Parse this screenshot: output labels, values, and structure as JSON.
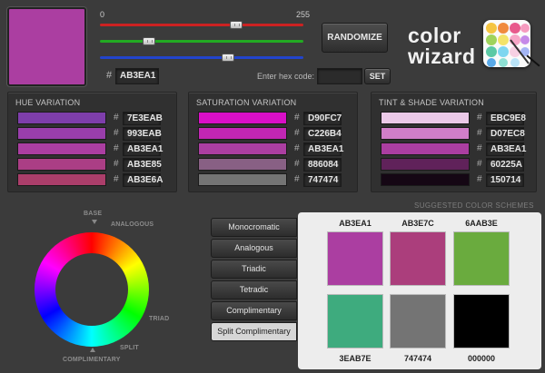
{
  "current": {
    "hex": "AB3EA1",
    "color": "#AB3EA1"
  },
  "sliders": {
    "min_label": "0",
    "max_label": "255",
    "red": {
      "value": 171,
      "track_color": "#cc2222"
    },
    "green": {
      "value": 62,
      "track_color": "#22aa22"
    },
    "blue": {
      "value": 161,
      "track_color": "#2244cc"
    }
  },
  "hex_entry": {
    "label": "Enter hex code:",
    "value": "",
    "set_button": "SET",
    "hash": "#"
  },
  "randomize_button": "RANDOMIZE",
  "logo": {
    "line1": "color",
    "line2": "wizard"
  },
  "panels": [
    {
      "title": "HUE VARIATION",
      "rows": [
        {
          "hex": "7E3EAB",
          "color": "#7E3EAB"
        },
        {
          "hex": "993EAB",
          "color": "#993EAB"
        },
        {
          "hex": "AB3EA1",
          "color": "#AB3EA1"
        },
        {
          "hex": "AB3E85",
          "color": "#AB3E85"
        },
        {
          "hex": "AB3E6A",
          "color": "#AB3E6A"
        }
      ]
    },
    {
      "title": "SATURATION VARIATION",
      "rows": [
        {
          "hex": "D90FC7",
          "color": "#D90FC7"
        },
        {
          "hex": "C226B4",
          "color": "#C226B4"
        },
        {
          "hex": "AB3EA1",
          "color": "#AB3EA1"
        },
        {
          "hex": "886084",
          "color": "#886084"
        },
        {
          "hex": "747474",
          "color": "#747474"
        }
      ]
    },
    {
      "title": "TINT & SHADE VARIATION",
      "rows": [
        {
          "hex": "EBC9E8",
          "color": "#EBC9E8"
        },
        {
          "hex": "D07EC8",
          "color": "#D07EC8"
        },
        {
          "hex": "AB3EA1",
          "color": "#AB3EA1"
        },
        {
          "hex": "60225A",
          "color": "#60225A"
        },
        {
          "hex": "150714",
          "color": "#150714"
        }
      ]
    }
  ],
  "wheel_labels": {
    "base": "BASE",
    "analogous": "ANALOGOUS",
    "triad": "TRIAD",
    "split": "SPLIT",
    "complimentary": "COMPLIMENTARY"
  },
  "schemes": {
    "tabs": [
      "Monocromatic",
      "Analogous",
      "Triadic",
      "Tetradic",
      "Complimentary",
      "Split Complimentary"
    ],
    "active": "Split Complimentary",
    "suggested_label": "SUGGESTED COLOR SCHEMES",
    "swatches": [
      {
        "hex": "AB3EA1",
        "color": "#AB3EA1"
      },
      {
        "hex": "AB3E7C",
        "color": "#AB3E7C"
      },
      {
        "hex": "6AAB3E",
        "color": "#6AAB3E"
      },
      {
        "hex": "3EAB7E",
        "color": "#3EAB7E"
      },
      {
        "hex": "747474",
        "color": "#747474"
      },
      {
        "hex": "000000",
        "color": "#000000"
      }
    ]
  }
}
